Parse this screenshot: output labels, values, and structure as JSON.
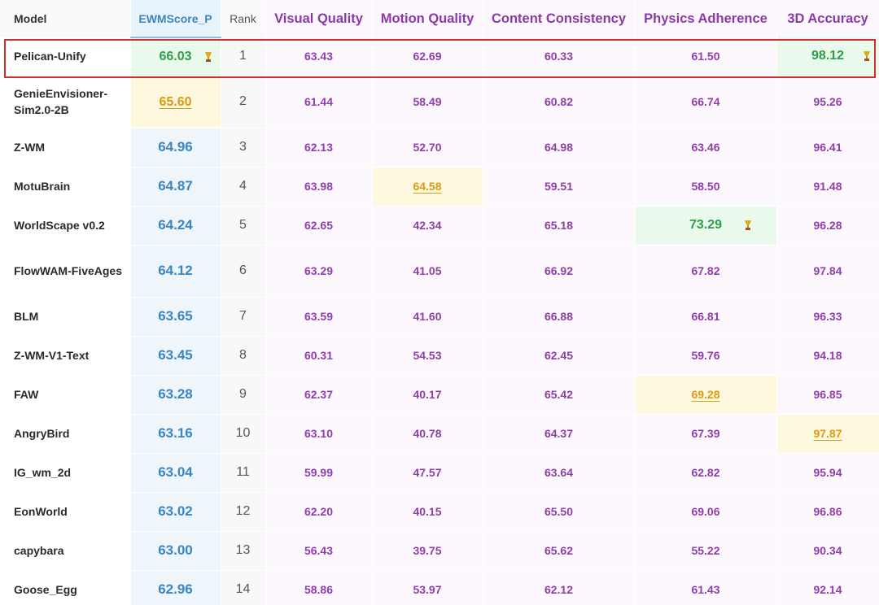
{
  "headers": {
    "model": "Model",
    "ewmscore": "EWMScore_P",
    "rank": "Rank",
    "visual_quality": "Visual Quality",
    "motion_quality": "Motion Quality",
    "content_consistency": "Content Consistency",
    "physics_adherence": "Physics Adherence",
    "accuracy_3d": "3D Accuracy"
  },
  "colors": {
    "metric_text": "#8e3fa8",
    "ewm_text": "#3a86c0",
    "best_text": "#2f9e4a",
    "best_bg": "#e9f9ec",
    "second_text": "#dc9a12",
    "second_bg": "#fdf8de",
    "highlight_border": "#cf2f2f"
  },
  "rows": [
    {
      "model": "Pelican-Unify",
      "ewm": "66.03",
      "rank": "1",
      "vq": "63.43",
      "mq": "62.69",
      "cc": "60.33",
      "pa": "61.50",
      "acc3d": "98.12"
    },
    {
      "model": "GenieEnvisioner-Sim2.0-2B",
      "ewm": "65.60",
      "rank": "2",
      "vq": "61.44",
      "mq": "58.49",
      "cc": "60.82",
      "pa": "66.74",
      "acc3d": "95.26"
    },
    {
      "model": "Z-WM",
      "ewm": "64.96",
      "rank": "3",
      "vq": "62.13",
      "mq": "52.70",
      "cc": "64.98",
      "pa": "63.46",
      "acc3d": "96.41"
    },
    {
      "model": "MotuBrain",
      "ewm": "64.87",
      "rank": "4",
      "vq": "63.98",
      "mq": "64.58",
      "cc": "59.51",
      "pa": "58.50",
      "acc3d": "91.48"
    },
    {
      "model": "WorldScape v0.2",
      "ewm": "64.24",
      "rank": "5",
      "vq": "62.65",
      "mq": "42.34",
      "cc": "65.18",
      "pa": "73.29",
      "acc3d": "96.28"
    },
    {
      "model": "FlowWAM-FiveAges",
      "ewm": "64.12",
      "rank": "6",
      "vq": "63.29",
      "mq": "41.05",
      "cc": "66.92",
      "pa": "67.82",
      "acc3d": "97.84"
    },
    {
      "model": "BLM",
      "ewm": "63.65",
      "rank": "7",
      "vq": "63.59",
      "mq": "41.60",
      "cc": "66.88",
      "pa": "66.81",
      "acc3d": "96.33"
    },
    {
      "model": "Z-WM-V1-Text",
      "ewm": "63.45",
      "rank": "8",
      "vq": "60.31",
      "mq": "54.53",
      "cc": "62.45",
      "pa": "59.76",
      "acc3d": "94.18"
    },
    {
      "model": "FAW",
      "ewm": "63.28",
      "rank": "9",
      "vq": "62.37",
      "mq": "40.17",
      "cc": "65.42",
      "pa": "69.28",
      "acc3d": "96.85"
    },
    {
      "model": "AngryBird",
      "ewm": "63.16",
      "rank": "10",
      "vq": "63.10",
      "mq": "40.78",
      "cc": "64.37",
      "pa": "67.39",
      "acc3d": "97.87"
    },
    {
      "model": "IG_wm_2d",
      "ewm": "63.04",
      "rank": "11",
      "vq": "59.99",
      "mq": "47.57",
      "cc": "63.64",
      "pa": "62.82",
      "acc3d": "95.94"
    },
    {
      "model": "EonWorld",
      "ewm": "63.02",
      "rank": "12",
      "vq": "62.20",
      "mq": "40.15",
      "cc": "65.50",
      "pa": "69.06",
      "acc3d": "96.86"
    },
    {
      "model": "capybara",
      "ewm": "63.00",
      "rank": "13",
      "vq": "56.43",
      "mq": "39.75",
      "cc": "65.62",
      "pa": "55.22",
      "acc3d": "90.34"
    },
    {
      "model": "Goose_Egg",
      "ewm": "62.96",
      "rank": "14",
      "vq": "58.86",
      "mq": "53.97",
      "cc": "62.12",
      "pa": "61.43",
      "acc3d": "92.14"
    }
  ]
}
